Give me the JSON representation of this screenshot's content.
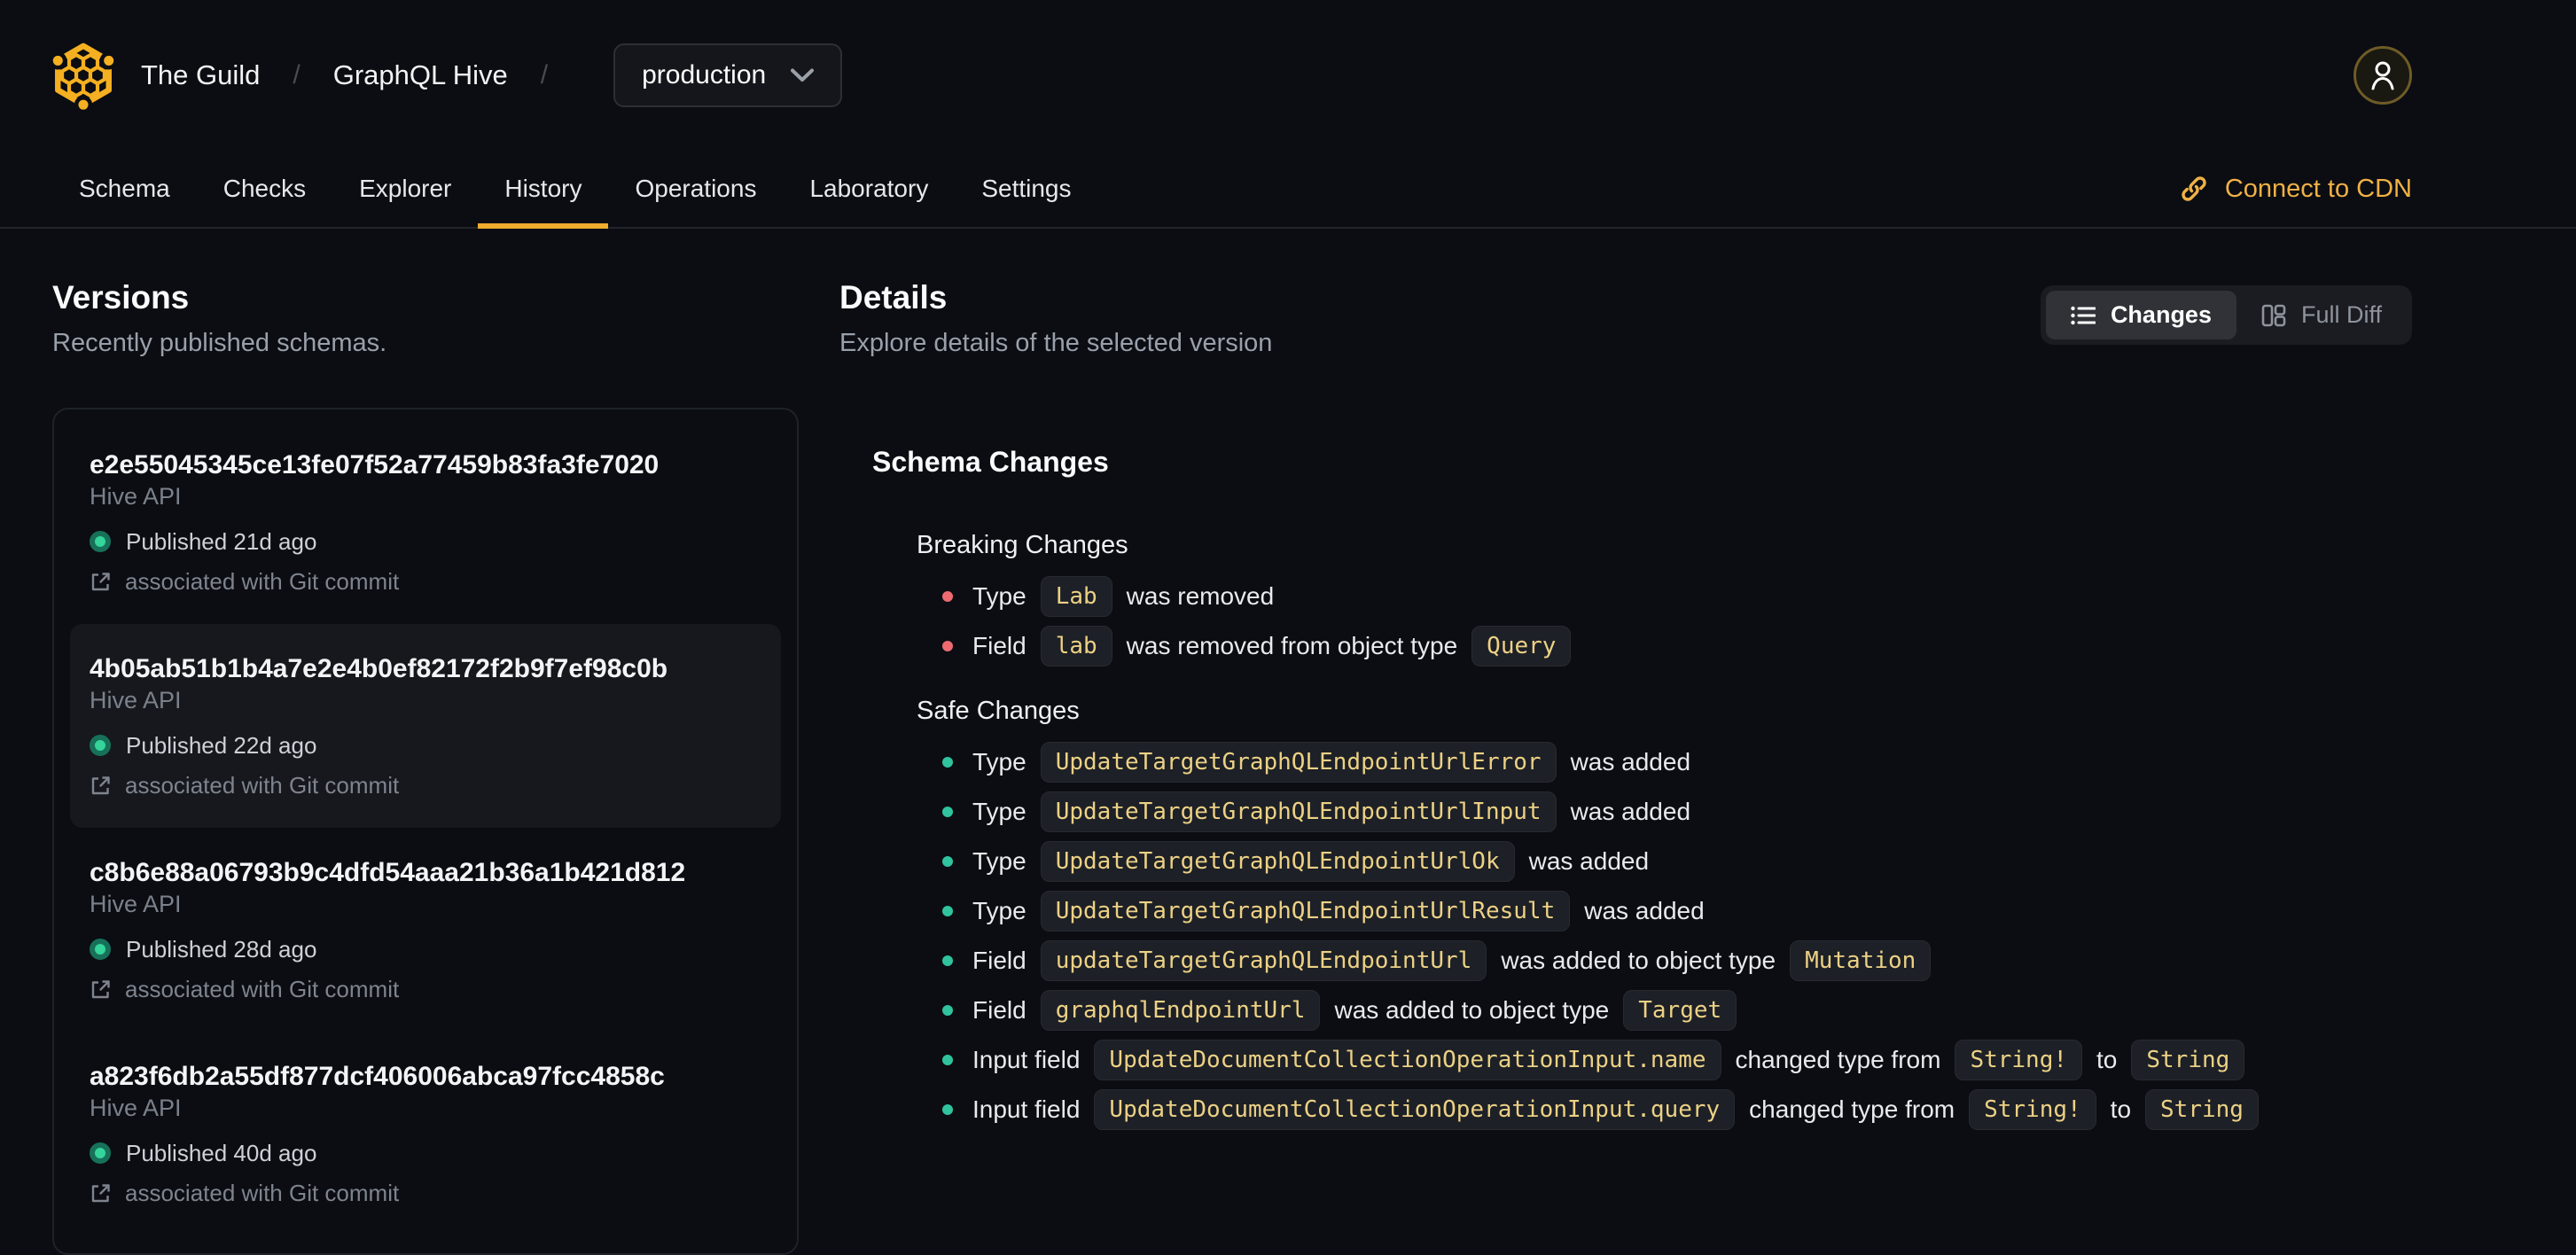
{
  "colors": {
    "accent_gold": "#efac2d",
    "cdn_link": "#f0b146",
    "breaking_bullet": "#ee6a71",
    "safe_bullet": "#30c39e",
    "published_dot": "#35d49a",
    "code_text": "#ecd185"
  },
  "header": {
    "org": "The Guild",
    "project": "GraphQL Hive",
    "separator": "/",
    "target": "production"
  },
  "nav": {
    "tabs": [
      {
        "label": "Schema",
        "active": false
      },
      {
        "label": "Checks",
        "active": false
      },
      {
        "label": "Explorer",
        "active": false
      },
      {
        "label": "History",
        "active": true
      },
      {
        "label": "Operations",
        "active": false
      },
      {
        "label": "Laboratory",
        "active": false
      },
      {
        "label": "Settings",
        "active": false
      }
    ],
    "cdn_link": "Connect to CDN"
  },
  "versions": {
    "title": "Versions",
    "subtitle": "Recently published schemas.",
    "items": [
      {
        "hash": "e2e55045345ce13fe07f52a77459b83fa3fe7020",
        "service": "Hive API",
        "published": "Published 21d ago",
        "commit": "associated with Git commit",
        "selected": false
      },
      {
        "hash": "4b05ab51b1b4a7e2e4b0ef82172f2b9f7ef98c0b",
        "service": "Hive API",
        "published": "Published 22d ago",
        "commit": "associated with Git commit",
        "selected": true
      },
      {
        "hash": "c8b6e88a06793b9c4dfd54aaa21b36a1b421d812",
        "service": "Hive API",
        "published": "Published 28d ago",
        "commit": "associated with Git commit",
        "selected": false
      },
      {
        "hash": "a823f6db2a55df877dcf406006abca97fcc4858c",
        "service": "Hive API",
        "published": "Published 40d ago",
        "commit": "associated with Git commit",
        "selected": false
      }
    ]
  },
  "details": {
    "title": "Details",
    "subtitle": "Explore details of the selected version",
    "view_modes": [
      {
        "label": "Changes",
        "icon": "list-icon",
        "active": true
      },
      {
        "label": "Full Diff",
        "icon": "columns-icon",
        "active": false
      }
    ],
    "schema_changes": {
      "title": "Schema Changes",
      "sections": [
        {
          "title": "Breaking Changes",
          "severity": "breaking",
          "items": [
            [
              {
                "text": "Type"
              },
              {
                "code": "Lab"
              },
              {
                "text": "was removed"
              }
            ],
            [
              {
                "text": "Field"
              },
              {
                "code": "lab"
              },
              {
                "text": "was removed from object type"
              },
              {
                "code": "Query"
              }
            ]
          ]
        },
        {
          "title": "Safe Changes",
          "severity": "safe",
          "items": [
            [
              {
                "text": "Type"
              },
              {
                "code": "UpdateTargetGraphQLEndpointUrlError"
              },
              {
                "text": "was added"
              }
            ],
            [
              {
                "text": "Type"
              },
              {
                "code": "UpdateTargetGraphQLEndpointUrlInput"
              },
              {
                "text": "was added"
              }
            ],
            [
              {
                "text": "Type"
              },
              {
                "code": "UpdateTargetGraphQLEndpointUrlOk"
              },
              {
                "text": "was added"
              }
            ],
            [
              {
                "text": "Type"
              },
              {
                "code": "UpdateTargetGraphQLEndpointUrlResult"
              },
              {
                "text": "was added"
              }
            ],
            [
              {
                "text": "Field"
              },
              {
                "code": "updateTargetGraphQLEndpointUrl"
              },
              {
                "text": "was added to object type"
              },
              {
                "code": "Mutation"
              }
            ],
            [
              {
                "text": "Field"
              },
              {
                "code": "graphqlEndpointUrl"
              },
              {
                "text": "was added to object type"
              },
              {
                "code": "Target"
              }
            ],
            [
              {
                "text": "Input field"
              },
              {
                "code": "UpdateDocumentCollectionOperationInput.name"
              },
              {
                "text": "changed type from"
              },
              {
                "code": "String!"
              },
              {
                "text": "to"
              },
              {
                "code": "String"
              }
            ],
            [
              {
                "text": "Input field"
              },
              {
                "code": "UpdateDocumentCollectionOperationInput.query"
              },
              {
                "text": "changed type from"
              },
              {
                "code": "String!"
              },
              {
                "text": "to"
              },
              {
                "code": "String"
              }
            ]
          ]
        }
      ]
    }
  }
}
